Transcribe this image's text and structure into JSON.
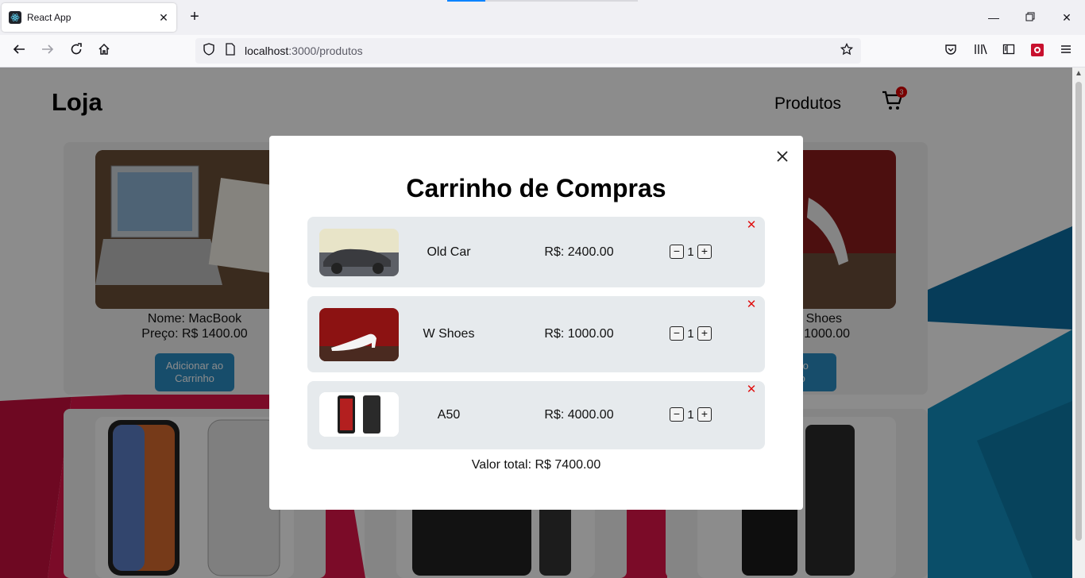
{
  "browser": {
    "tab_title": "React App",
    "url_host": "localhost",
    "url_rest": ":3000/produtos",
    "accent_color": "#0a84ff"
  },
  "header": {
    "brand": "Loja",
    "nav_link": "Produtos",
    "cart_count": "3"
  },
  "products": [
    {
      "name": "Nome: MacBook",
      "price": "Preço: R$ 1400.00",
      "button": "Adicionar ao Carrinho"
    },
    {
      "name": "Shoes",
      "price": "1000.00",
      "button": "ar ao\nnho"
    }
  ],
  "modal": {
    "title": "Carrinho de Compras",
    "close_icon": "close-icon",
    "items": [
      {
        "name": "Old Car",
        "price": "R$: 2400.00",
        "qty": "1",
        "minus": "−",
        "plus": "+",
        "remove": "✕"
      },
      {
        "name": "W Shoes",
        "price": "R$: 1000.00",
        "qty": "1",
        "minus": "−",
        "plus": "+",
        "remove": "✕"
      },
      {
        "name": "A50",
        "price": "R$: 4000.00",
        "qty": "1",
        "minus": "−",
        "plus": "+",
        "remove": "✕"
      }
    ],
    "total": "Valor total: R$ 7400.00"
  },
  "colors": {
    "button_blue": "#2a8cc4",
    "remove_red": "#e01010",
    "item_bg": "#e6eaed"
  }
}
